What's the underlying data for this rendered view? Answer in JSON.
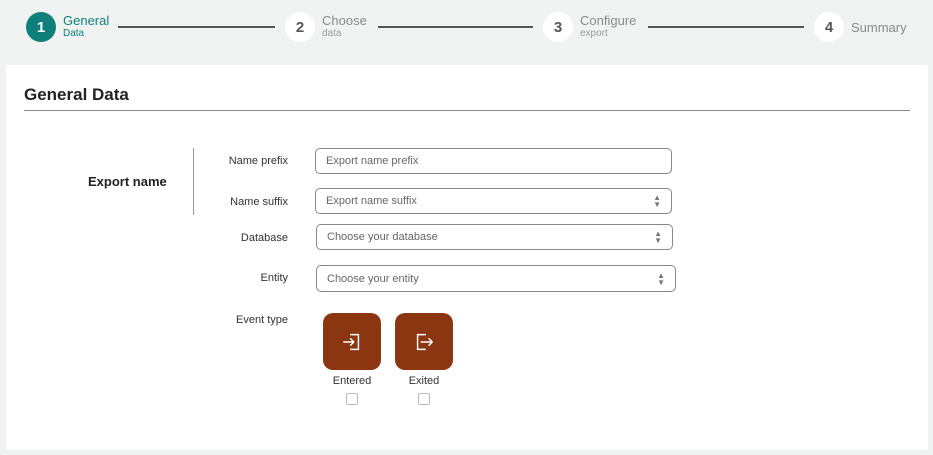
{
  "stepper": {
    "steps": [
      {
        "number": "1",
        "label": "General",
        "sub": "Data"
      },
      {
        "number": "2",
        "label": "Choose",
        "sub": "data"
      },
      {
        "number": "3",
        "label": "Configure",
        "sub": "export"
      },
      {
        "number": "4",
        "label": "Summary",
        "sub": ""
      }
    ],
    "active_step": 1
  },
  "card": {
    "title": "General Data",
    "group_label": "Export name",
    "fields": [
      {
        "label": "Name prefix",
        "placeholder": "Export name prefix"
      },
      {
        "label": "Name suffix",
        "placeholder": "Export name suffix"
      },
      {
        "label": "Database",
        "placeholder": "Choose your database"
      },
      {
        "label": "Entity",
        "placeholder": "Choose your entity"
      }
    ],
    "event_type": {
      "label": "Event type",
      "options": [
        {
          "label": "Entered",
          "icon": "login-icon",
          "checked": false
        },
        {
          "label": "Exited",
          "icon": "logout-icon",
          "checked": false
        }
      ]
    }
  },
  "colors": {
    "accent": "#0e7f7a",
    "event_button": "#8b3511"
  }
}
